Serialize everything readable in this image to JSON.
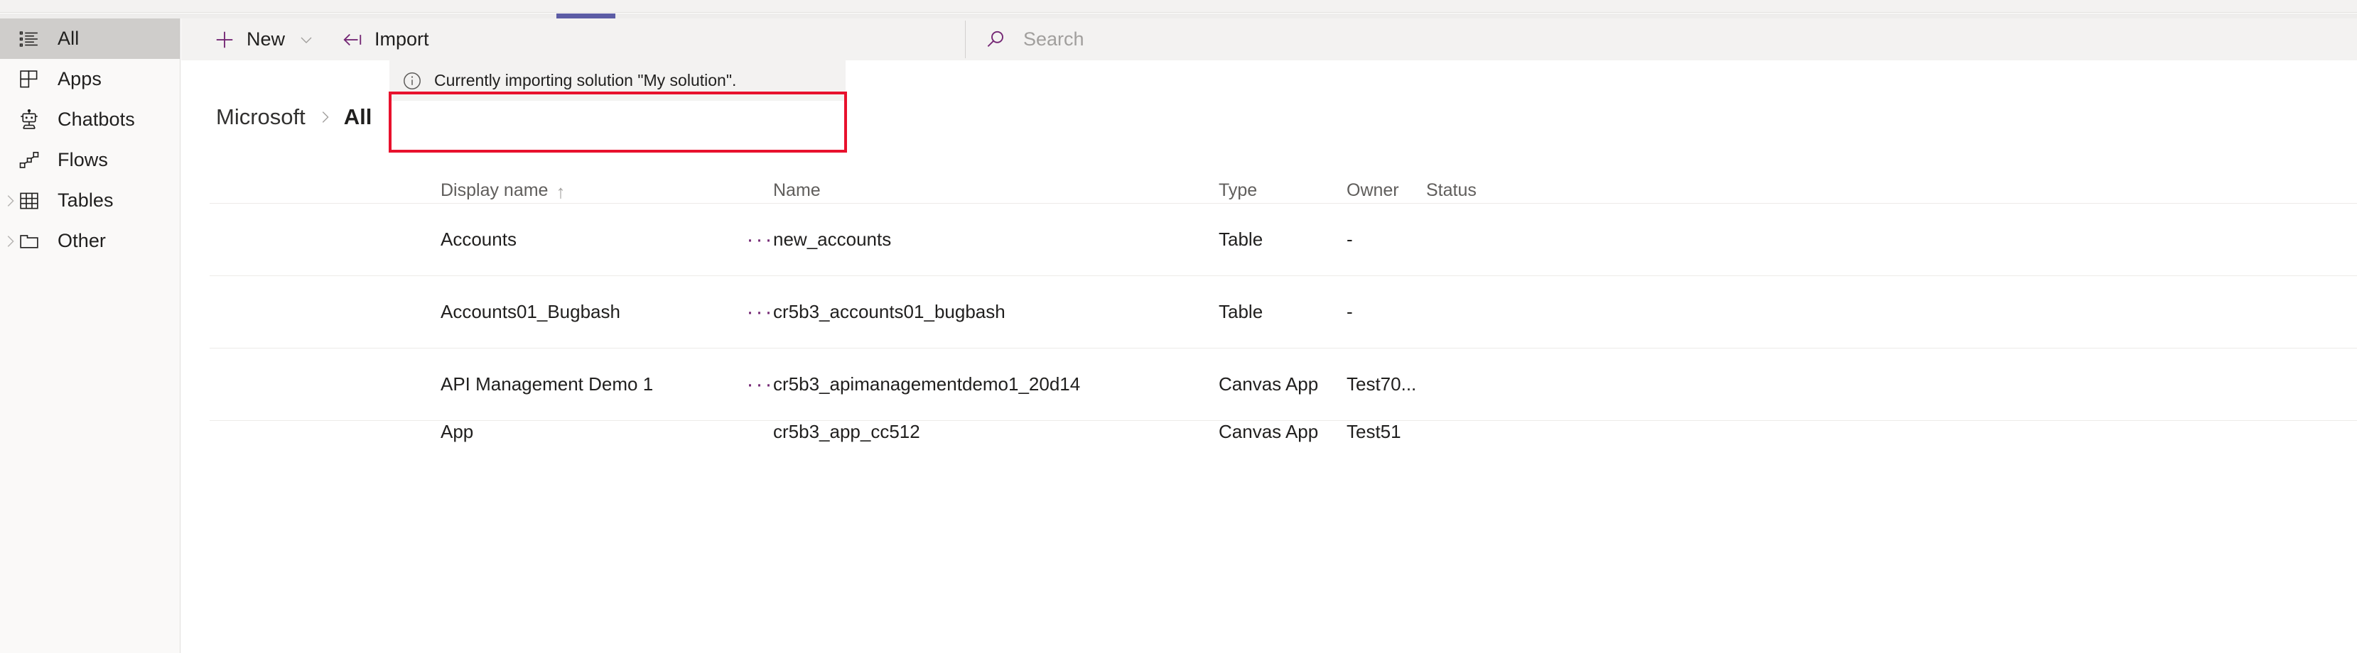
{
  "sidebar": {
    "items": [
      {
        "label": "All",
        "icon": "list-icon",
        "selected": true,
        "expandable": false
      },
      {
        "label": "Apps",
        "icon": "apps-icon",
        "selected": false,
        "expandable": false
      },
      {
        "label": "Chatbots",
        "icon": "robot-icon",
        "selected": false,
        "expandable": false
      },
      {
        "label": "Flows",
        "icon": "flow-icon",
        "selected": false,
        "expandable": false
      },
      {
        "label": "Tables",
        "icon": "table-icon",
        "selected": false,
        "expandable": true
      },
      {
        "label": "Other",
        "icon": "folder-icon",
        "selected": false,
        "expandable": true
      }
    ]
  },
  "commandbar": {
    "new_label": "New",
    "new_icon": "plus-icon",
    "new_caret_icon": "chevron-down-icon",
    "import_label": "Import",
    "import_icon": "import-arrow-icon"
  },
  "search": {
    "placeholder": "Search",
    "value": "",
    "icon": "search-icon"
  },
  "banner": {
    "icon": "info-icon",
    "message": "Currently importing solution \"My solution\"."
  },
  "breadcrumb": {
    "root": "Microsoft",
    "separator": "›",
    "current": "All"
  },
  "table": {
    "columns": [
      {
        "key": "display_name",
        "label": "Display name",
        "sorted": true,
        "sort_arrow": "↑"
      },
      {
        "key": "name",
        "label": "Name",
        "sorted": false,
        "sort_arrow": ""
      },
      {
        "key": "type",
        "label": "Type",
        "sorted": false,
        "sort_arrow": ""
      },
      {
        "key": "owner",
        "label": "Owner",
        "sorted": false,
        "sort_arrow": ""
      },
      {
        "key": "status",
        "label": "Status",
        "sorted": false,
        "sort_arrow": ""
      }
    ],
    "row_menu_label": "···",
    "rows": [
      {
        "display_name": "Accounts",
        "name": "new_accounts",
        "type": "Table",
        "owner": "-",
        "status": ""
      },
      {
        "display_name": "Accounts01_Bugbash",
        "name": "cr5b3_accounts01_bugbash",
        "type": "Table",
        "owner": "-",
        "status": ""
      },
      {
        "display_name": "API Management Demo 1",
        "name": "cr5b3_apimanagementdemo1_20d14",
        "type": "Canvas App",
        "owner": "Test70...",
        "status": ""
      },
      {
        "display_name": "App",
        "name": "cr5b3_app_cc512",
        "type": "Canvas App",
        "owner": "Test51",
        "status": ""
      }
    ]
  },
  "colors": {
    "accent_purple": "#742774",
    "tab_indicator": "#5c5ca5",
    "annotation_red": "#e8112d",
    "selected_nav": "#cfcdcb"
  }
}
